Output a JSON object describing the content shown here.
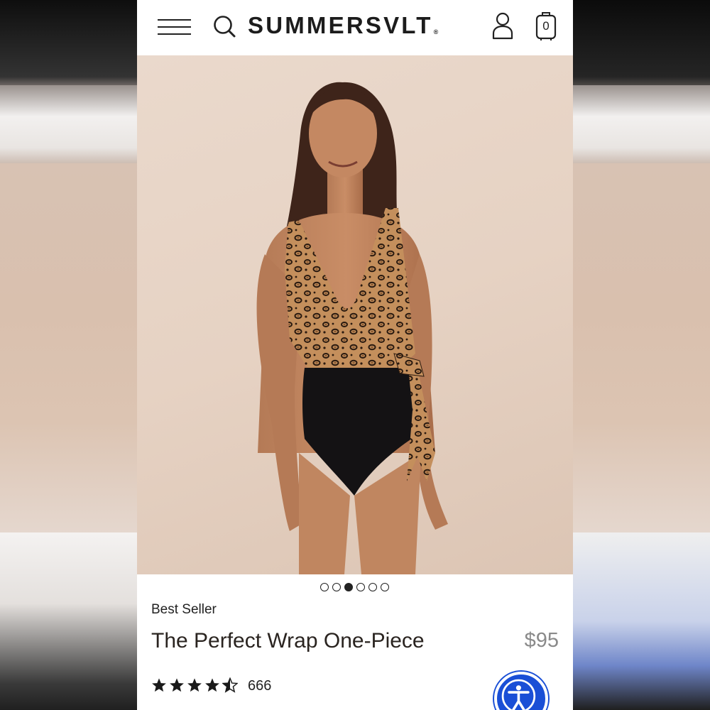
{
  "header": {
    "brand": "SUMMERSVLT",
    "registered_mark": "®",
    "bag_count": "0"
  },
  "carousel": {
    "total_slides": 6,
    "active_index": 2
  },
  "product": {
    "badge": "Best Seller",
    "title": "The Perfect Wrap One-Piece",
    "price": "$95",
    "rating": 4.5,
    "review_count": "666"
  },
  "colors": {
    "accessibility_blue": "#1a4fd6",
    "text_dark": "#222222",
    "price_gray": "#8a8a8a"
  },
  "icons": [
    "menu-icon",
    "search-icon",
    "account-icon",
    "bag-icon",
    "star-icon",
    "accessibility-icon"
  ]
}
